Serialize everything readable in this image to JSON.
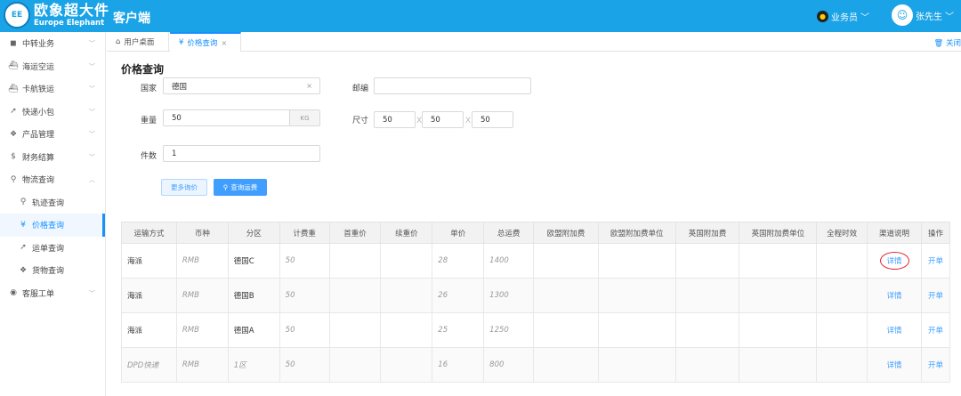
{
  "brand": {
    "logo_badge": "EE",
    "name_cn": "欧象超大件",
    "name_en": "Europe Elephant",
    "app_title": "客户端"
  },
  "header": {
    "role": "业务员",
    "user": "张先生"
  },
  "sidebar": {
    "items": [
      {
        "label": "中转业务",
        "icon": "car-icon"
      },
      {
        "label": "海运空运",
        "icon": "ship-icon"
      },
      {
        "label": "卡航铁运",
        "icon": "train-icon"
      },
      {
        "label": "快递小包",
        "icon": "send-icon"
      },
      {
        "label": "产品管理",
        "icon": "product-icon"
      },
      {
        "label": "财务结算",
        "icon": "dollar-icon"
      },
      {
        "label": "物流查询",
        "icon": "search-icon"
      },
      {
        "label": "轨迹查询",
        "icon": "location-icon"
      },
      {
        "label": "价格查询",
        "icon": "yen-icon"
      },
      {
        "label": "运单查询",
        "icon": "send-icon"
      },
      {
        "label": "货物查询",
        "icon": "goods-icon"
      },
      {
        "label": "客服工单",
        "icon": "eye-icon"
      }
    ]
  },
  "tabs": {
    "home": "用户桌面",
    "active": "价格查询",
    "close_all": "关闭"
  },
  "form": {
    "title": "价格查询",
    "country_label": "国家",
    "country_value": "德国",
    "postcode_label": "邮编",
    "postcode_value": "",
    "weight_label": "重量",
    "weight_value": "50",
    "weight_unit": "KG",
    "size_label": "尺寸",
    "size_l": "50",
    "size_w": "50",
    "size_h": "50",
    "size_sep": "X",
    "count_label": "件数",
    "count_value": "1",
    "more_button": "更多询价",
    "query_button": "查询运费"
  },
  "table": {
    "headers": [
      "运输方式",
      "币种",
      "分区",
      "计费重",
      "首重价",
      "续重价",
      "单价",
      "总运费",
      "欧盟附加费",
      "欧盟附加费单位",
      "英国附加费",
      "英国附加费单位",
      "全程时效",
      "渠道说明",
      "操作"
    ],
    "rows": [
      {
        "method": "海派",
        "currency": "RMB",
        "zone": "德国C",
        "weight": "50",
        "first": "",
        "next": "",
        "unit_price": "28",
        "total": "1400",
        "eu": "",
        "eu_unit": "",
        "uk": "",
        "uk_unit": "",
        "time": "",
        "detail": "详情",
        "action": "开单"
      },
      {
        "method": "海派",
        "currency": "RMB",
        "zone": "德国B",
        "weight": "50",
        "first": "",
        "next": "",
        "unit_price": "26",
        "total": "1300",
        "eu": "",
        "eu_unit": "",
        "uk": "",
        "uk_unit": "",
        "time": "",
        "detail": "详情",
        "action": "开单"
      },
      {
        "method": "海派",
        "currency": "RMB",
        "zone": "德国A",
        "weight": "50",
        "first": "",
        "next": "",
        "unit_price": "25",
        "total": "1250",
        "eu": "",
        "eu_unit": "",
        "uk": "",
        "uk_unit": "",
        "time": "",
        "detail": "详情",
        "action": "开单"
      },
      {
        "method": "DPD快递",
        "currency": "RMB",
        "zone": "1区",
        "weight": "50",
        "first": "",
        "next": "",
        "unit_price": "16",
        "total": "800",
        "eu": "",
        "eu_unit": "",
        "uk": "",
        "uk_unit": "",
        "time": "",
        "detail": "详情",
        "action": "开单"
      }
    ]
  },
  "colors": {
    "primary": "#1aa3e6",
    "link": "#409eff",
    "highlight_circle": "#e0252b"
  }
}
